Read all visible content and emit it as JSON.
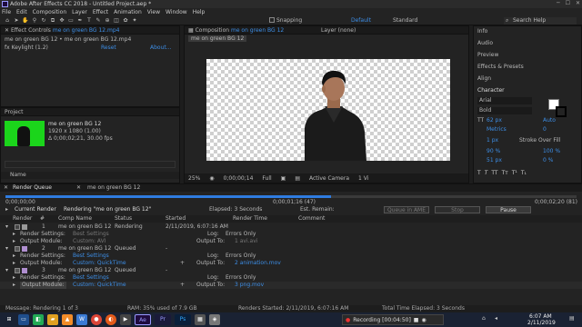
{
  "app": {
    "title": "Adobe After Effects CC 2018 - Untitled Project.aep *"
  },
  "menu": [
    "File",
    "Edit",
    "Composition",
    "Layer",
    "Effect",
    "Animation",
    "View",
    "Window",
    "Help"
  ],
  "toolbar": {
    "snapping": "Snapping",
    "workspace": [
      "Default",
      "Standard"
    ],
    "search_placeholder": "Search Help"
  },
  "effect_controls": {
    "tab": "Effect Controls",
    "tab_value": "me on green BG 12.mp4",
    "path": "me on green BG 12 • me on green BG 12.mp4",
    "effect_name": "Keylight (1.2)",
    "reset": "Reset",
    "about": "About..."
  },
  "project": {
    "tab": "Project",
    "item_name": "me on green BG 12",
    "item_info": [
      "1920 x 1080 (1.00)",
      "Δ 0;00;02;21, 30.00 fps"
    ],
    "column_name": "Name"
  },
  "composition": {
    "tab_label": "Composition",
    "tab_value": "me on green BG 12",
    "layer_tab": "Layer  (none)",
    "sub_tab": "me on green BG 12",
    "zoom": "25%",
    "timecode": "0;00;00;14",
    "resolution": "Full",
    "camera": "Active Camera",
    "view": "1 Vi"
  },
  "right_panel": {
    "items": [
      "Info",
      "Audio",
      "Preview",
      "Effects & Presets",
      "Align"
    ],
    "character": {
      "title": "Character",
      "font": "Arial",
      "style": "Bold",
      "size": "62 px",
      "leading": "Auto",
      "kerning": "Metrics",
      "tracking": "0",
      "stroke_size": "1 px",
      "stroke_mode": "Stroke Over Fill",
      "vscale": "90 %",
      "hscale": "100 %",
      "baseline": "51 px",
      "tsume": "0 %"
    }
  },
  "render_queue": {
    "tab": "Render Queue",
    "comp_tab": "me on green BG 12",
    "time_start": "0;00;00;00",
    "time_mid": "0;00;01;16 (47)",
    "time_end": "0;00;02;20 (81)",
    "current_render_label": "Current Render",
    "rendering_label": "Rendering \"me on green BG 12\"",
    "elapsed": "Elapsed: 3 Seconds",
    "est_remain": "Est. Remain:",
    "queue_ame": "Queue in AME",
    "stop": "Stop",
    "pause": "Pause",
    "columns": [
      "Render",
      "#",
      "Comp Name",
      "Status",
      "Started",
      "Render Time",
      "Comment"
    ],
    "items": [
      {
        "num": "1",
        "name": "me on green BG 12",
        "status": "Rendering",
        "started": "2/11/2019, 6:07:16 AM",
        "settings_label": "Render Settings:",
        "settings_value": "Best Settings",
        "output_label": "Output Module:",
        "output_value": "Custom: AVI",
        "log_label": "Log:",
        "log_value": "Errors Only",
        "out_to_label": "Output To:",
        "out_to_value": "1 avi.avi"
      },
      {
        "num": "2",
        "name": "me on green BG 12",
        "status": "Queued",
        "started": "-",
        "settings_label": "Render Settings:",
        "settings_value": "Best Settings",
        "output_label": "Output Module:",
        "output_value": "Custom: QuickTime",
        "log_label": "Log:",
        "log_value": "Errors Only",
        "out_to_label": "Output To:",
        "out_to_value": "2 animation.mov"
      },
      {
        "num": "3",
        "name": "me on green BG 12",
        "status": "Queued",
        "started": "-",
        "settings_label": "Render Settings:",
        "settings_value": "Best Settings",
        "output_label": "Output Module:",
        "output_value": "Custom: QuickTime",
        "log_label": "Log:",
        "log_value": "Errors Only",
        "out_to_label": "Output To:",
        "out_to_value": "3 png.mov"
      }
    ]
  },
  "status": {
    "message": "Message:  Rendering 1 of 3",
    "ram": "RAM:  35% used of 7.9 GB",
    "renders_started": "Renders Started:  2/11/2019, 6:07:16 AM",
    "total_time": "Total Time Elapsed:  3 Seconds"
  },
  "taskbar": {
    "recording": "Recording [00:04:50]",
    "time": "6:07 AM",
    "date": "2/11/2019",
    "apps": [
      "Ae",
      "Pr",
      "Ps"
    ]
  },
  "colors": {
    "accent": "#2f7ce0",
    "link": "#3d8ee6",
    "green_screen": "#1bd51b",
    "ae_purple": "#9999ff"
  }
}
